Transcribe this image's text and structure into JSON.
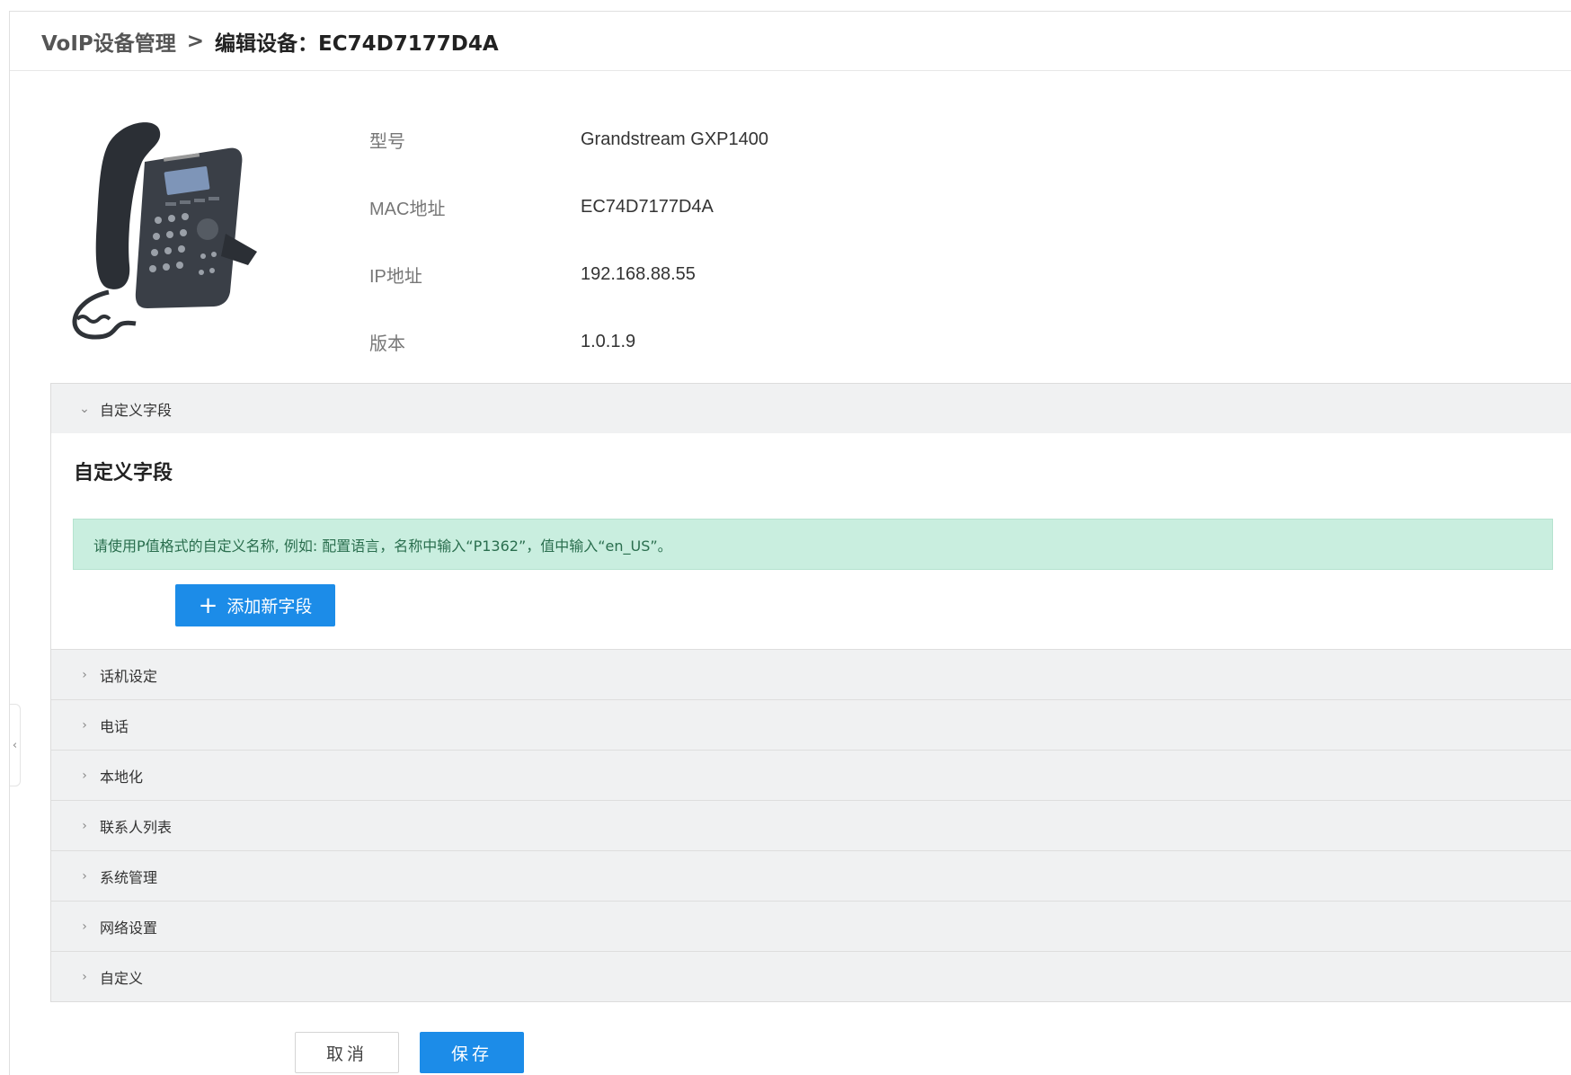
{
  "breadcrumb": {
    "parent": "VoIP设备管理",
    "separator": ">",
    "current": "编辑设备：EC74D7177D4A"
  },
  "device_info": [
    {
      "label": "型号",
      "value": "Grandstream GXP1400"
    },
    {
      "label": "MAC地址",
      "value": "EC74D7177D4A"
    },
    {
      "label": "IP地址",
      "value": "192.168.88.55"
    },
    {
      "label": "版本",
      "value": "1.0.1.9"
    }
  ],
  "custom_fields": {
    "header": "自定义字段",
    "title": "自定义字段",
    "tip": "请使用P值格式的自定义名称, 例如: 配置语言，名称中输入“P1362”，值中输入“en_US”。",
    "add_button": "添加新字段"
  },
  "sections": [
    {
      "label": "话机设定"
    },
    {
      "label": "电话"
    },
    {
      "label": "本地化"
    },
    {
      "label": "联系人列表"
    },
    {
      "label": "系统管理"
    },
    {
      "label": "网络设置"
    },
    {
      "label": "自定义"
    }
  ],
  "footer": {
    "cancel": "取消",
    "save": "保存"
  },
  "colors": {
    "primary": "#1c8ce8",
    "tip_background": "#c9eedf",
    "tip_text": "#2a6e4e",
    "accordion_background": "#f0f1f2"
  },
  "icons": [
    "phone-image",
    "chevron-down-icon",
    "chevron-right-icon",
    "plus-icon",
    "collapse-left-icon"
  ]
}
